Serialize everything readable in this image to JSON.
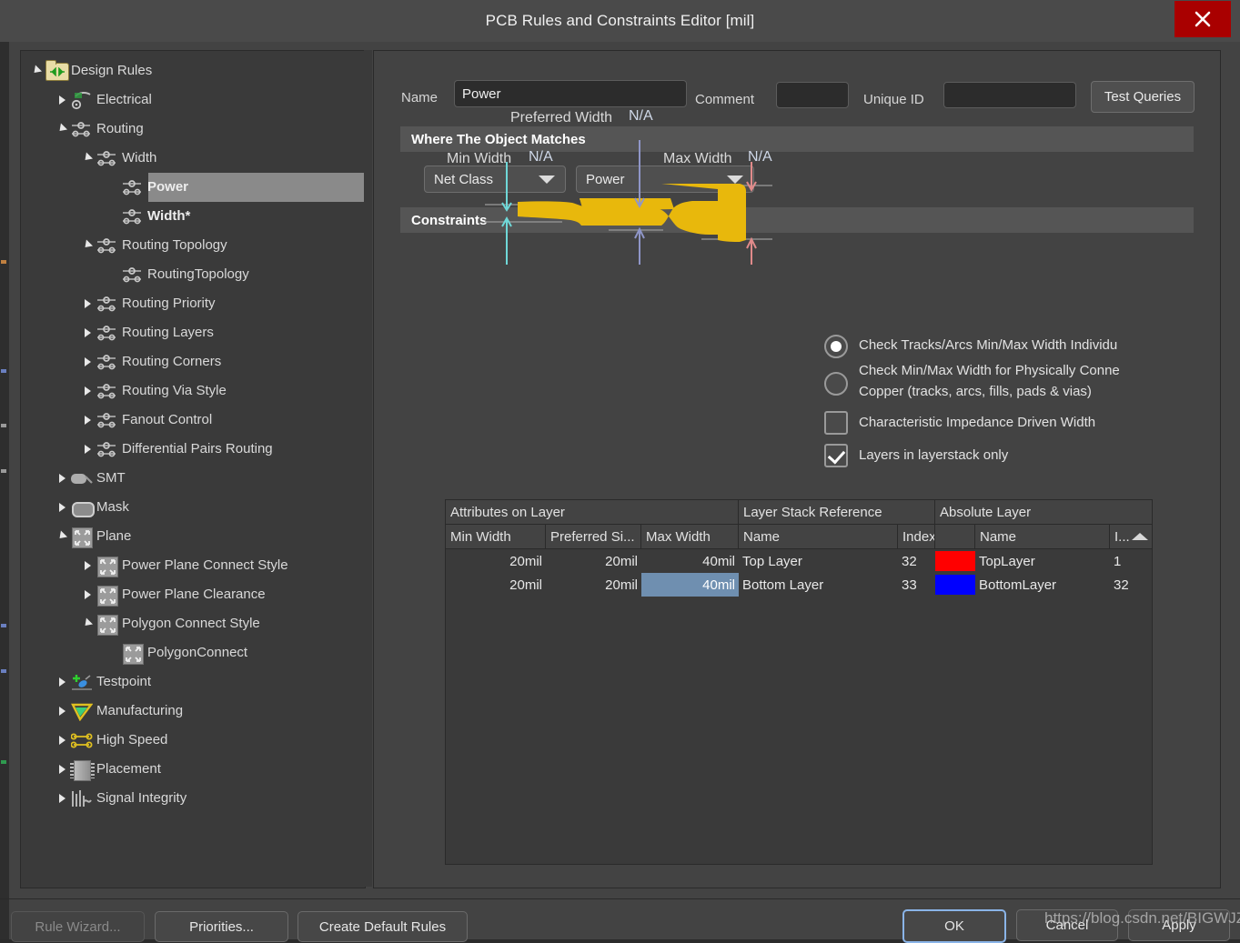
{
  "window": {
    "title": "PCB Rules and Constraints Editor [mil]",
    "close_icon": "close-icon"
  },
  "tree": {
    "root_label": "Design Rules",
    "items": [
      {
        "label": "Design Rules",
        "depth": 0,
        "icon": "folder-icon",
        "state": "expanded",
        "selected": false,
        "bold": false
      },
      {
        "label": "Electrical",
        "depth": 1,
        "icon": "electrical-icon",
        "state": "collapsed",
        "selected": false,
        "bold": false
      },
      {
        "label": "Routing",
        "depth": 1,
        "icon": "routing-icon",
        "state": "expanded",
        "selected": false,
        "bold": false
      },
      {
        "label": "Width",
        "depth": 2,
        "icon": "routing-icon",
        "state": "expanded",
        "selected": false,
        "bold": false
      },
      {
        "label": "Power",
        "depth": 3,
        "icon": "routing-icon",
        "state": "leaf",
        "selected": true,
        "bold": true
      },
      {
        "label": "Width*",
        "depth": 3,
        "icon": "routing-icon",
        "state": "leaf",
        "selected": false,
        "bold": true
      },
      {
        "label": "Routing Topology",
        "depth": 2,
        "icon": "routing-icon",
        "state": "expanded",
        "selected": false,
        "bold": false
      },
      {
        "label": "RoutingTopology",
        "depth": 3,
        "icon": "routing-icon",
        "state": "leaf",
        "selected": false,
        "bold": false
      },
      {
        "label": "Routing Priority",
        "depth": 2,
        "icon": "routing-icon",
        "state": "collapsed",
        "selected": false,
        "bold": false
      },
      {
        "label": "Routing Layers",
        "depth": 2,
        "icon": "routing-icon",
        "state": "collapsed",
        "selected": false,
        "bold": false
      },
      {
        "label": "Routing Corners",
        "depth": 2,
        "icon": "routing-icon",
        "state": "collapsed",
        "selected": false,
        "bold": false
      },
      {
        "label": "Routing Via Style",
        "depth": 2,
        "icon": "routing-icon",
        "state": "collapsed",
        "selected": false,
        "bold": false
      },
      {
        "label": "Fanout Control",
        "depth": 2,
        "icon": "routing-icon",
        "state": "collapsed",
        "selected": false,
        "bold": false
      },
      {
        "label": "Differential Pairs Routing",
        "depth": 2,
        "icon": "routing-icon",
        "state": "collapsed",
        "selected": false,
        "bold": false
      },
      {
        "label": "SMT",
        "depth": 1,
        "icon": "smt-icon",
        "state": "collapsed",
        "selected": false,
        "bold": false
      },
      {
        "label": "Mask",
        "depth": 1,
        "icon": "mask-icon",
        "state": "collapsed",
        "selected": false,
        "bold": false
      },
      {
        "label": "Plane",
        "depth": 1,
        "icon": "plane-icon",
        "state": "expanded",
        "selected": false,
        "bold": false
      },
      {
        "label": "Power Plane Connect Style",
        "depth": 2,
        "icon": "plane-icon",
        "state": "collapsed",
        "selected": false,
        "bold": false
      },
      {
        "label": "Power Plane Clearance",
        "depth": 2,
        "icon": "plane-icon",
        "state": "collapsed",
        "selected": false,
        "bold": false
      },
      {
        "label": "Polygon Connect Style",
        "depth": 2,
        "icon": "plane-icon",
        "state": "expanded",
        "selected": false,
        "bold": false
      },
      {
        "label": "PolygonConnect",
        "depth": 3,
        "icon": "plane-icon",
        "state": "leaf",
        "selected": false,
        "bold": false
      },
      {
        "label": "Testpoint",
        "depth": 1,
        "icon": "testpoint-icon",
        "state": "collapsed",
        "selected": false,
        "bold": false
      },
      {
        "label": "Manufacturing",
        "depth": 1,
        "icon": "manufacturing-icon",
        "state": "collapsed",
        "selected": false,
        "bold": false
      },
      {
        "label": "High Speed",
        "depth": 1,
        "icon": "high-speed-icon",
        "state": "collapsed",
        "selected": false,
        "bold": false
      },
      {
        "label": "Placement",
        "depth": 1,
        "icon": "placement-icon",
        "state": "collapsed",
        "selected": false,
        "bold": false
      },
      {
        "label": "Signal Integrity",
        "depth": 1,
        "icon": "signal-integrity-icon",
        "state": "collapsed",
        "selected": false,
        "bold": false
      }
    ]
  },
  "form": {
    "name_label": "Name",
    "name_value": "Power",
    "comment_label": "Comment",
    "comment_value": "",
    "unique_id_label": "Unique ID",
    "unique_id_value": "",
    "test_queries_label": "Test Queries"
  },
  "where_section": {
    "header": "Where The Object Matches",
    "scope_type": "Net Class",
    "scope_value": "Power"
  },
  "constraints": {
    "header": "Constraints",
    "diagram": {
      "preferred_width_label": "Preferred Width",
      "preferred_width_value": "N/A",
      "min_width_label": "Min Width",
      "min_width_value": "N/A",
      "max_width_label": "Max Width",
      "max_width_value": "N/A",
      "track_color": "#e8b80c",
      "min_arrow_color": "#6fd8d8",
      "pref_arrow_color": "#8f96c8",
      "max_arrow_color": "#e08a8a"
    },
    "options": [
      {
        "type": "radio",
        "label": "Check Tracks/Arcs Min/Max Width Individu",
        "checked": true
      },
      {
        "type": "radio",
        "label": "Check Min/Max Width for Physically Conne\nCopper (tracks, arcs, fills, pads & vias)",
        "checked": false
      },
      {
        "type": "checkbox",
        "label": "Characteristic Impedance Driven Width",
        "checked": false
      },
      {
        "type": "checkbox",
        "label": "Layers in layerstack only",
        "checked": true
      }
    ]
  },
  "table": {
    "group_headers": [
      {
        "label": "Attributes on Layer"
      },
      {
        "label": "Layer Stack Reference"
      },
      {
        "label": "Absolute Layer"
      }
    ],
    "columns": [
      "Min Width",
      "Preferred Si...",
      "Max Width",
      "Name",
      "Index",
      "",
      "Name",
      "I..."
    ],
    "sort_indicator": "sort-ascending-icon",
    "rows": [
      {
        "min_width": "20mil",
        "preferred_size": "20mil",
        "max_width": "40mil",
        "max_width_selected": false,
        "stack_name": "Top Layer",
        "stack_index": "32",
        "color": "#ff0000",
        "abs_name": "TopLayer",
        "abs_index": "1"
      },
      {
        "min_width": "20mil",
        "preferred_size": "20mil",
        "max_width": "40mil",
        "max_width_selected": true,
        "stack_name": "Bottom Layer",
        "stack_index": "33",
        "color": "#0000ff",
        "abs_name": "BottomLayer",
        "abs_index": "32"
      }
    ]
  },
  "footer": {
    "rule_wizard": "Rule Wizard...",
    "priorities": "Priorities...",
    "create_default_rules": "Create Default Rules",
    "ok": "OK",
    "cancel": "Cancel",
    "apply": "Apply"
  },
  "watermark": "https://blog.csdn.net/BIGWJZ"
}
